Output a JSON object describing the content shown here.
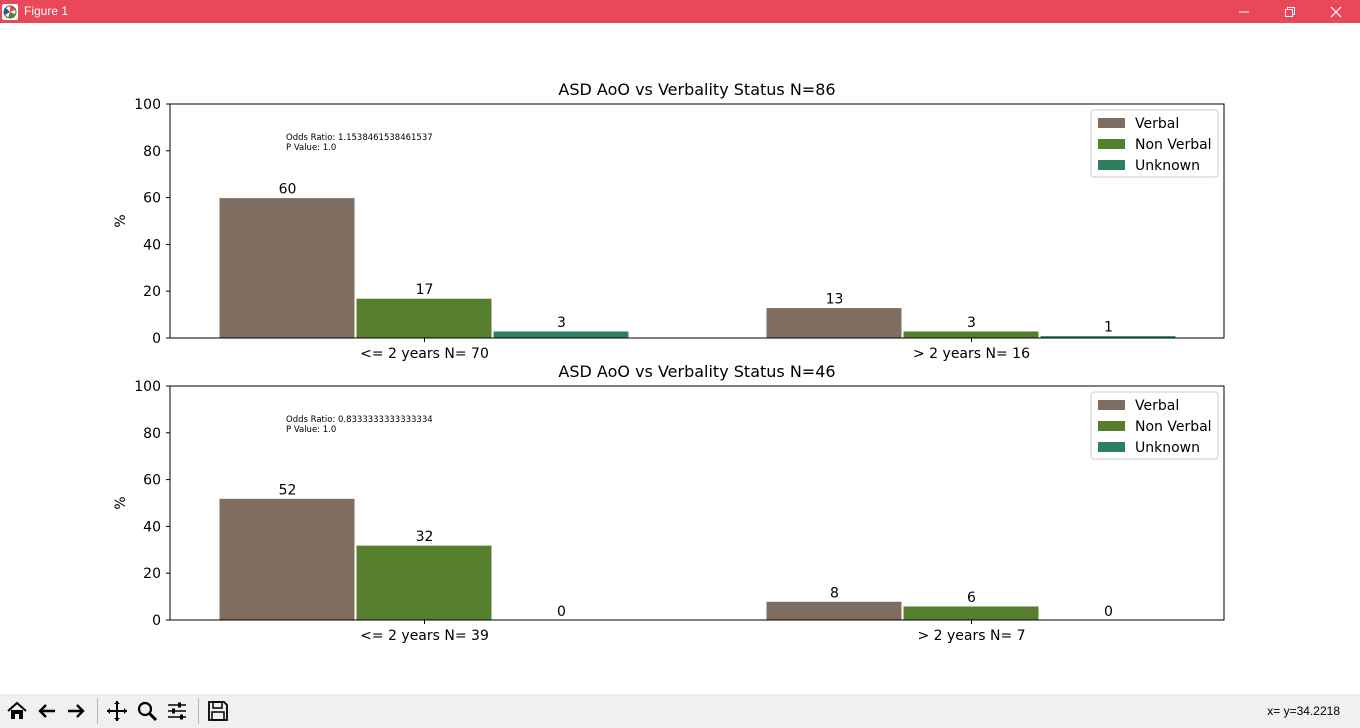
{
  "window": {
    "title": "Figure 1"
  },
  "status": {
    "coords": "x= y=34.2218"
  },
  "colors": {
    "titlebar": "#e94858",
    "verbal": "#7f6d5f",
    "non_verbal": "#557f2d",
    "unknown": "#2d7f5e"
  },
  "toolbar": {
    "icons": [
      "home-icon",
      "back-arrow-icon",
      "forward-arrow-icon",
      "pan-icon",
      "zoom-icon",
      "configure-subplots-icon",
      "save-icon"
    ]
  },
  "chart_data": [
    {
      "type": "bar",
      "title": "ASD AoO vs Verbality Status N=86",
      "xlabel": "",
      "ylabel": "%",
      "ylim": [
        0,
        100
      ],
      "yticks": [
        0,
        20,
        40,
        60,
        80,
        100
      ],
      "categories": [
        "<= 2 years N= 70",
        "> 2 years N= 16"
      ],
      "series": [
        {
          "name": "Verbal",
          "values": [
            60,
            13
          ],
          "labels": [
            "60",
            "13"
          ]
        },
        {
          "name": "Non Verbal",
          "values": [
            17,
            3
          ],
          "labels": [
            "17",
            "3"
          ]
        },
        {
          "name": "Unknown",
          "values": [
            3,
            1
          ],
          "labels": [
            "3",
            "1"
          ]
        }
      ],
      "annotation": [
        "Odds Ratio: 1.1538461538461537",
        "P Value: 1.0"
      ],
      "legend": "top-right",
      "grid": false
    },
    {
      "type": "bar",
      "title": "ASD AoO vs Verbality Status N=46",
      "xlabel": "",
      "ylabel": "%",
      "ylim": [
        0,
        100
      ],
      "yticks": [
        0,
        20,
        40,
        60,
        80,
        100
      ],
      "categories": [
        "<= 2 years N= 39",
        "> 2 years N= 7"
      ],
      "series": [
        {
          "name": "Verbal",
          "values": [
            52,
            8
          ],
          "labels": [
            "52",
            "8"
          ]
        },
        {
          "name": "Non Verbal",
          "values": [
            32,
            6
          ],
          "labels": [
            "32",
            "6"
          ]
        },
        {
          "name": "Unknown",
          "values": [
            0,
            0
          ],
          "labels": [
            "0",
            "0"
          ]
        }
      ],
      "annotation": [
        "Odds Ratio: 0.8333333333333334",
        "P Value: 1.0"
      ],
      "legend": "top-right",
      "grid": false
    }
  ]
}
